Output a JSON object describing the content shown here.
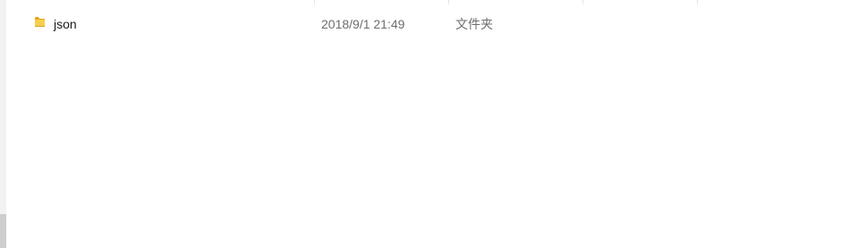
{
  "files": [
    {
      "name": "json",
      "modified": "2018/9/1 21:49",
      "type": "文件夹",
      "icon": "folder-icon"
    }
  ],
  "colors": {
    "folder_yellow": "#f7cf4e",
    "folder_dark": "#e1a916",
    "name_text": "#1a1a1a",
    "meta_text": "#6d6d6d"
  }
}
